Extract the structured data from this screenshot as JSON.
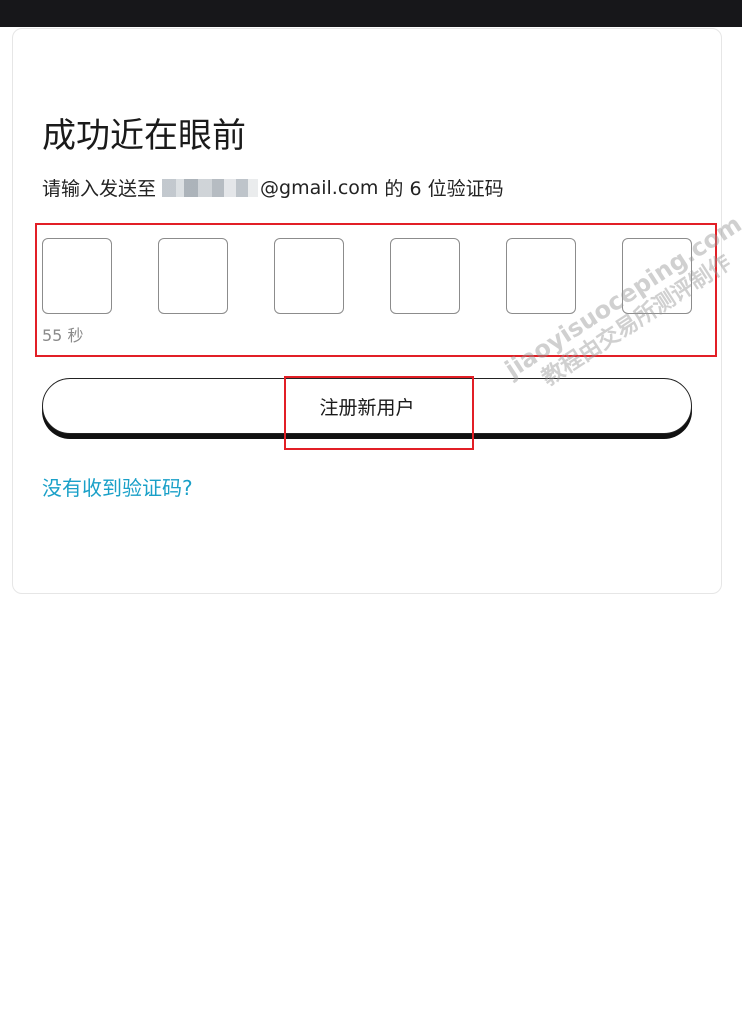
{
  "card": {
    "title": "成功近在眼前",
    "subtitle_prefix": "请输入发送至",
    "email_suffix": "@gmail.com",
    "subtitle_suffix": "的 6 位验证码"
  },
  "code": {
    "cells": [
      "",
      "",
      "",
      "",
      "",
      ""
    ],
    "countdown": "55 秒"
  },
  "actions": {
    "register_label": "注册新用户",
    "resend_label": "没有收到验证码?"
  },
  "watermark": {
    "line1": "jiaoyisuoceping.com",
    "line2": "教程由交易所测评制作"
  },
  "colors": {
    "topbar": "#17171a",
    "link": "#1aa0c8",
    "highlight": "#e21f26"
  }
}
